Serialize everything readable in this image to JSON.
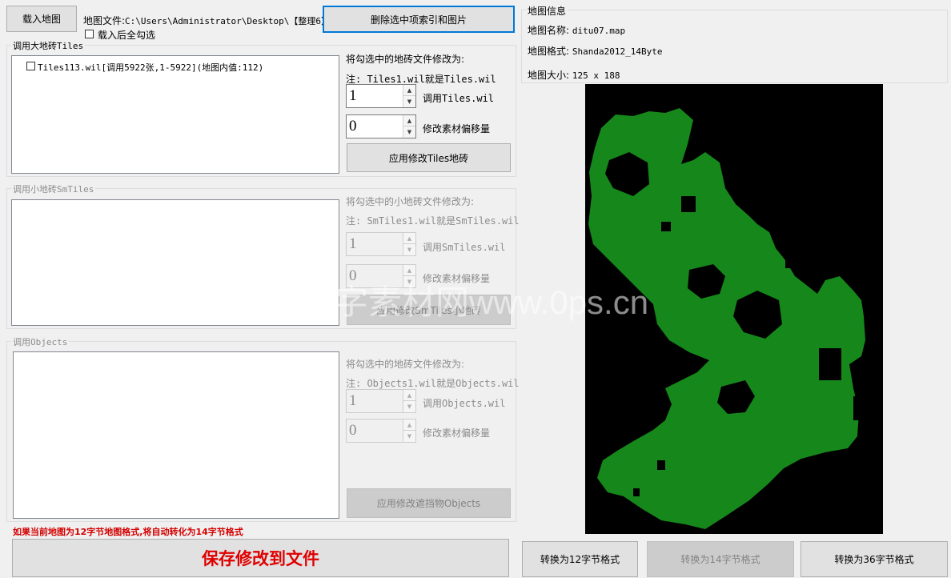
{
  "toolbar": {
    "load_map": "载入地图",
    "map_file_label": "地图文件:",
    "map_file_path": "C:\\Users\\Administrator\\Desktop\\【整理6】:",
    "delete_button": "删除选中项索引和图片",
    "select_all_after_load": "载入后全勾选"
  },
  "tiles": {
    "title": "调用大地砖Tiles",
    "items": [
      {
        "label": "Tiles113.wil[调用5922张,1-5922](地图内值:112)",
        "checked": false
      }
    ],
    "modify_label": "将勾选中的地砖文件修改为:",
    "note": "注: Tiles1.wil就是Tiles.wil",
    "index_value": "1",
    "index_label": "调用Tiles.wil",
    "offset_value": "0",
    "offset_label": "修改素材偏移量",
    "apply_button": "应用修改Tiles地砖"
  },
  "smtiles": {
    "title": "调用小地砖SmTiles",
    "modify_label": "将勾选中的小地砖文件修改为:",
    "note": "注: SmTiles1.wil就是SmTiles.wil",
    "index_value": "1",
    "index_label": "调用SmTiles.wil",
    "offset_value": "0",
    "offset_label": "修改素材偏移量",
    "apply_button": "应用修改SmTiles小地砖"
  },
  "objects": {
    "title": "调用Objects",
    "modify_label": "将勾选中的地砖文件修改为:",
    "note": "注: Objects1.wil就是Objects.wil",
    "index_value": "1",
    "index_label": "调用Objects.wil",
    "offset_value": "0",
    "offset_label": "修改素材偏移量",
    "apply_button": "应用修改遮挡物Objects"
  },
  "warning": "如果当前地图为12字节地图格式,将自动转化为14字节格式",
  "save_button": "保存修改到文件",
  "map_info": {
    "title": "地图信息",
    "name_label": "地图名称:",
    "name_value": "ditu07.map",
    "format_label": "地图格式:",
    "format_value": "Shanda2012_14Byte",
    "size_label": "地图大小:",
    "size_value": "125 x 188"
  },
  "convert": {
    "to12": "转换为12字节格式",
    "to14": "转换为14字节格式",
    "to36": "转换为36字节格式"
  },
  "watermark": "字素材网www.0ps.cn",
  "colors": {
    "map_land": "#16871a",
    "map_bg": "#000000",
    "warning_text": "#d40000",
    "save_text": "#e00000",
    "focus_border": "#0078d7"
  }
}
